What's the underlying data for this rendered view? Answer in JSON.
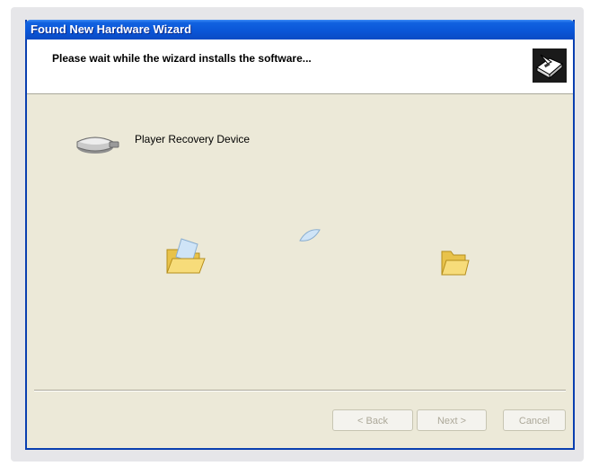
{
  "window": {
    "title": "Found New Hardware Wizard",
    "header_text": "Please wait while the wizard installs the software..."
  },
  "device": {
    "name": "Player Recovery Device"
  },
  "buttons": {
    "back": "< Back",
    "next": "Next >",
    "cancel": "Cancel"
  },
  "icons": {
    "header": "hardware-wizard-icon",
    "device": "usb-drive-icon",
    "source": "open-folder-icon",
    "destination": "folder-icon",
    "transfer": "flying-paper-icon"
  },
  "colors": {
    "titlebar": "#0a55d6",
    "dialog_bg": "#ece9d8",
    "header_bg": "#ffffff"
  }
}
